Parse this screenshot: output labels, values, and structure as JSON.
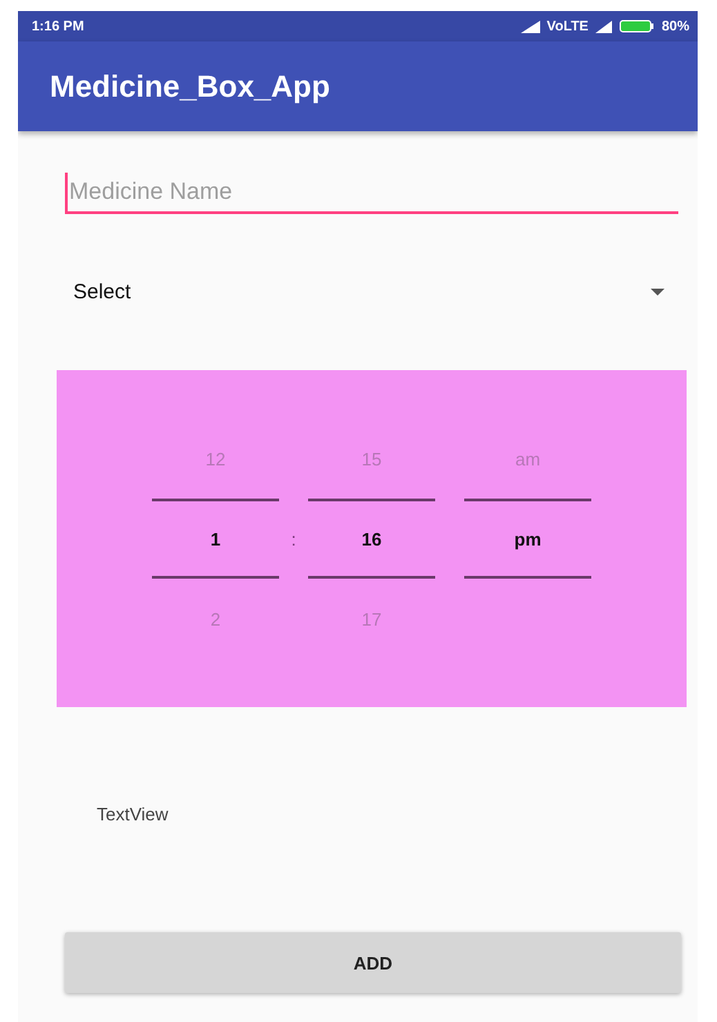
{
  "status_bar": {
    "time": "1:16 PM",
    "network": "VoLTE",
    "battery": "80%"
  },
  "app_bar": {
    "title": "Medicine_Box_App"
  },
  "medicine_field": {
    "placeholder": "Medicine Name"
  },
  "spinner": {
    "value": "Select"
  },
  "time_picker": {
    "separator": ":",
    "columns": [
      {
        "previous": "12",
        "current": "1",
        "next": "2"
      },
      {
        "previous": "15",
        "current": "16",
        "next": "17"
      },
      {
        "previous": "am",
        "current": "pm"
      }
    ]
  },
  "text_view": "TextView",
  "add_button": "ADD"
}
